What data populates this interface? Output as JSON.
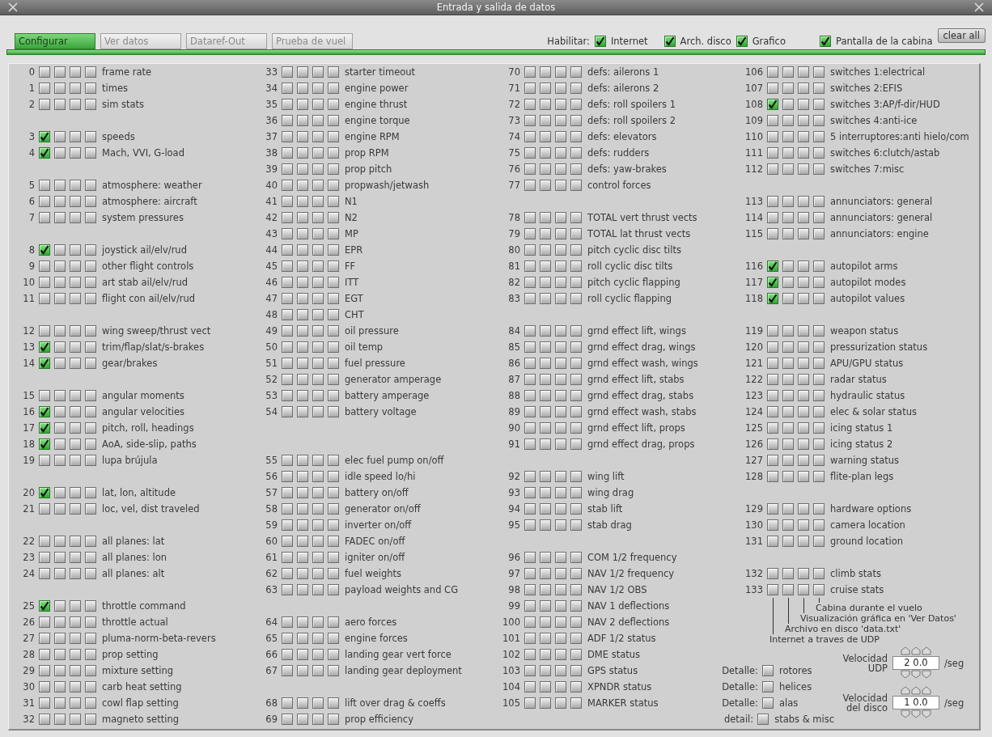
{
  "window": {
    "title": "Entrada y salida de datos"
  },
  "tabs": [
    {
      "label": "Configurar",
      "selected": true
    },
    {
      "label": "Ver datos",
      "selected": false
    },
    {
      "label": "Dataref-Out",
      "selected": false
    },
    {
      "label": "Prueba de vuel",
      "selected": false
    }
  ],
  "enable": {
    "label": "Habilitar:",
    "options": [
      {
        "label": "Internet",
        "checked": true
      },
      {
        "label": "Arch. disco",
        "checked": true
      },
      {
        "label": "Grafico",
        "checked": true
      },
      {
        "label": "Pantalla de la cabina",
        "checked": true
      }
    ]
  },
  "clear_button": "clear all",
  "columns": [
    {
      "rows": [
        {
          "kind": "entry",
          "number": "0",
          "label": "frame rate",
          "checks": [
            false,
            false,
            false,
            false
          ]
        },
        {
          "kind": "entry",
          "number": "1",
          "label": "times",
          "checks": [
            false,
            false,
            false,
            false
          ]
        },
        {
          "kind": "entry",
          "number": "2",
          "label": "sim stats",
          "checks": [
            false,
            false,
            false,
            false
          ]
        },
        {
          "kind": "blank"
        },
        {
          "kind": "entry",
          "number": "3",
          "label": "speeds",
          "checks": [
            true,
            false,
            false,
            false
          ]
        },
        {
          "kind": "entry",
          "number": "4",
          "label": "Mach, VVI, G-load",
          "checks": [
            true,
            false,
            false,
            false
          ]
        },
        {
          "kind": "blank"
        },
        {
          "kind": "entry",
          "number": "5",
          "label": "atmosphere: weather",
          "checks": [
            false,
            false,
            false,
            false
          ]
        },
        {
          "kind": "entry",
          "number": "6",
          "label": "atmosphere: aircraft",
          "checks": [
            false,
            false,
            false,
            false
          ]
        },
        {
          "kind": "entry",
          "number": "7",
          "label": "system pressures",
          "checks": [
            false,
            false,
            false,
            false
          ]
        },
        {
          "kind": "blank"
        },
        {
          "kind": "entry",
          "number": "8",
          "label": "joystick ail/elv/rud",
          "checks": [
            true,
            false,
            false,
            false
          ]
        },
        {
          "kind": "entry",
          "number": "9",
          "label": "other flight controls",
          "checks": [
            false,
            false,
            false,
            false
          ]
        },
        {
          "kind": "entry",
          "number": "10",
          "label": "art stab ail/elv/rud",
          "checks": [
            false,
            false,
            false,
            false
          ]
        },
        {
          "kind": "entry",
          "number": "11",
          "label": "flight con ail/elv/rud",
          "checks": [
            false,
            false,
            false,
            false
          ]
        },
        {
          "kind": "blank"
        },
        {
          "kind": "entry",
          "number": "12",
          "label": "wing sweep/thrust vect",
          "checks": [
            false,
            false,
            false,
            false
          ]
        },
        {
          "kind": "entry",
          "number": "13",
          "label": "trim/flap/slat/s-brakes",
          "checks": [
            true,
            false,
            false,
            false
          ]
        },
        {
          "kind": "entry",
          "number": "14",
          "label": "gear/brakes",
          "checks": [
            true,
            false,
            false,
            false
          ]
        },
        {
          "kind": "blank"
        },
        {
          "kind": "entry",
          "number": "15",
          "label": "angular moments",
          "checks": [
            false,
            false,
            false,
            false
          ]
        },
        {
          "kind": "entry",
          "number": "16",
          "label": "angular velocities",
          "checks": [
            true,
            false,
            false,
            false
          ]
        },
        {
          "kind": "entry",
          "number": "17",
          "label": "pitch, roll, headings",
          "checks": [
            true,
            false,
            false,
            false
          ]
        },
        {
          "kind": "entry",
          "number": "18",
          "label": "AoA, side-slip, paths",
          "checks": [
            true,
            false,
            false,
            false
          ]
        },
        {
          "kind": "entry",
          "number": "19",
          "label": "lupa brújula",
          "checks": [
            false,
            false,
            false,
            false
          ]
        },
        {
          "kind": "blank"
        },
        {
          "kind": "entry",
          "number": "20",
          "label": "lat, lon, altitude",
          "checks": [
            true,
            false,
            false,
            false
          ]
        },
        {
          "kind": "entry",
          "number": "21",
          "label": "loc, vel, dist traveled",
          "checks": [
            false,
            false,
            false,
            false
          ]
        },
        {
          "kind": "blank"
        },
        {
          "kind": "entry",
          "number": "22",
          "label": "all planes: lat",
          "checks": [
            false,
            false,
            false,
            false
          ]
        },
        {
          "kind": "entry",
          "number": "23",
          "label": "all planes: lon",
          "checks": [
            false,
            false,
            false,
            false
          ]
        },
        {
          "kind": "entry",
          "number": "24",
          "label": "all planes: alt",
          "checks": [
            false,
            false,
            false,
            false
          ]
        },
        {
          "kind": "blank"
        },
        {
          "kind": "entry",
          "number": "25",
          "label": "throttle command",
          "checks": [
            true,
            false,
            false,
            false
          ]
        },
        {
          "kind": "entry",
          "number": "26",
          "label": "throttle actual",
          "checks": [
            false,
            false,
            false,
            false
          ]
        },
        {
          "kind": "entry",
          "number": "27",
          "label": "pluma-norm-beta-revers",
          "checks": [
            false,
            false,
            false,
            false
          ]
        },
        {
          "kind": "entry",
          "number": "28",
          "label": "prop setting",
          "checks": [
            false,
            false,
            false,
            false
          ]
        },
        {
          "kind": "entry",
          "number": "29",
          "label": "mixture setting",
          "checks": [
            false,
            false,
            false,
            false
          ]
        },
        {
          "kind": "entry",
          "number": "30",
          "label": "carb heat setting",
          "checks": [
            false,
            false,
            false,
            false
          ]
        },
        {
          "kind": "entry",
          "number": "31",
          "label": "cowl flap setting",
          "checks": [
            false,
            false,
            false,
            false
          ]
        },
        {
          "kind": "entry",
          "number": "32",
          "label": "magneto setting",
          "checks": [
            false,
            false,
            false,
            false
          ]
        }
      ]
    },
    {
      "rows": [
        {
          "kind": "entry",
          "number": "33",
          "label": "starter timeout",
          "checks": [
            false,
            false,
            false,
            false
          ]
        },
        {
          "kind": "entry",
          "number": "34",
          "label": "engine power",
          "checks": [
            false,
            false,
            false,
            false
          ]
        },
        {
          "kind": "entry",
          "number": "35",
          "label": "engine thrust",
          "checks": [
            false,
            false,
            false,
            false
          ]
        },
        {
          "kind": "entry",
          "number": "36",
          "label": "engine torque",
          "checks": [
            false,
            false,
            false,
            false
          ]
        },
        {
          "kind": "entry",
          "number": "37",
          "label": "engine RPM",
          "checks": [
            false,
            false,
            false,
            false
          ]
        },
        {
          "kind": "entry",
          "number": "38",
          "label": "prop RPM",
          "checks": [
            false,
            false,
            false,
            false
          ]
        },
        {
          "kind": "entry",
          "number": "39",
          "label": "prop pitch",
          "checks": [
            false,
            false,
            false,
            false
          ]
        },
        {
          "kind": "entry",
          "number": "40",
          "label": "propwash/jetwash",
          "checks": [
            false,
            false,
            false,
            false
          ]
        },
        {
          "kind": "entry",
          "number": "41",
          "label": "N1",
          "checks": [
            false,
            false,
            false,
            false
          ]
        },
        {
          "kind": "entry",
          "number": "42",
          "label": "N2",
          "checks": [
            false,
            false,
            false,
            false
          ]
        },
        {
          "kind": "entry",
          "number": "43",
          "label": "MP",
          "checks": [
            false,
            false,
            false,
            false
          ]
        },
        {
          "kind": "entry",
          "number": "44",
          "label": "EPR",
          "checks": [
            false,
            false,
            false,
            false
          ]
        },
        {
          "kind": "entry",
          "number": "45",
          "label": "FF",
          "checks": [
            false,
            false,
            false,
            false
          ]
        },
        {
          "kind": "entry",
          "number": "46",
          "label": "ITT",
          "checks": [
            false,
            false,
            false,
            false
          ]
        },
        {
          "kind": "entry",
          "number": "47",
          "label": "EGT",
          "checks": [
            false,
            false,
            false,
            false
          ]
        },
        {
          "kind": "entry",
          "number": "48",
          "label": "CHT",
          "checks": [
            false,
            false,
            false,
            false
          ]
        },
        {
          "kind": "entry",
          "number": "49",
          "label": "oil pressure",
          "checks": [
            false,
            false,
            false,
            false
          ]
        },
        {
          "kind": "entry",
          "number": "50",
          "label": "oil temp",
          "checks": [
            false,
            false,
            false,
            false
          ]
        },
        {
          "kind": "entry",
          "number": "51",
          "label": "fuel pressure",
          "checks": [
            false,
            false,
            false,
            false
          ]
        },
        {
          "kind": "entry",
          "number": "52",
          "label": "generator amperage",
          "checks": [
            false,
            false,
            false,
            false
          ]
        },
        {
          "kind": "entry",
          "number": "53",
          "label": "battery amperage",
          "checks": [
            false,
            false,
            false,
            false
          ]
        },
        {
          "kind": "entry",
          "number": "54",
          "label": "battery voltage",
          "checks": [
            false,
            false,
            false,
            false
          ]
        },
        {
          "kind": "blank"
        },
        {
          "kind": "blank"
        },
        {
          "kind": "entry",
          "number": "55",
          "label": "elec fuel pump on/off",
          "checks": [
            false,
            false,
            false,
            false
          ]
        },
        {
          "kind": "entry",
          "number": "56",
          "label": "idle speed lo/hi",
          "checks": [
            false,
            false,
            false,
            false
          ]
        },
        {
          "kind": "entry",
          "number": "57",
          "label": "battery on/off",
          "checks": [
            false,
            false,
            false,
            false
          ]
        },
        {
          "kind": "entry",
          "number": "58",
          "label": "generator on/off",
          "checks": [
            false,
            false,
            false,
            false
          ]
        },
        {
          "kind": "entry",
          "number": "59",
          "label": "inverter on/off",
          "checks": [
            false,
            false,
            false,
            false
          ]
        },
        {
          "kind": "entry",
          "number": "60",
          "label": "FADEC on/off",
          "checks": [
            false,
            false,
            false,
            false
          ]
        },
        {
          "kind": "entry",
          "number": "61",
          "label": "igniter on/off",
          "checks": [
            false,
            false,
            false,
            false
          ]
        },
        {
          "kind": "entry",
          "number": "62",
          "label": "fuel weights",
          "checks": [
            false,
            false,
            false,
            false
          ]
        },
        {
          "kind": "entry",
          "number": "63",
          "label": "payload weights and CG",
          "checks": [
            false,
            false,
            false,
            false
          ]
        },
        {
          "kind": "blank"
        },
        {
          "kind": "entry",
          "number": "64",
          "label": "aero forces",
          "checks": [
            false,
            false,
            false,
            false
          ]
        },
        {
          "kind": "entry",
          "number": "65",
          "label": "engine forces",
          "checks": [
            false,
            false,
            false,
            false
          ]
        },
        {
          "kind": "entry",
          "number": "66",
          "label": "landing gear vert force",
          "checks": [
            false,
            false,
            false,
            false
          ]
        },
        {
          "kind": "entry",
          "number": "67",
          "label": "landing gear deployment",
          "checks": [
            false,
            false,
            false,
            false
          ]
        },
        {
          "kind": "blank"
        },
        {
          "kind": "entry",
          "number": "68",
          "label": "lift over drag & coeffs",
          "checks": [
            false,
            false,
            false,
            false
          ]
        },
        {
          "kind": "entry",
          "number": "69",
          "label": "prop efficiency",
          "checks": [
            false,
            false,
            false,
            false
          ]
        }
      ]
    },
    {
      "rows": [
        {
          "kind": "entry",
          "number": "70",
          "label": "defs: ailerons 1",
          "checks": [
            false,
            false,
            false,
            false
          ]
        },
        {
          "kind": "entry",
          "number": "71",
          "label": "defs: ailerons 2",
          "checks": [
            false,
            false,
            false,
            false
          ]
        },
        {
          "kind": "entry",
          "number": "72",
          "label": "defs: roll spoilers 1",
          "checks": [
            false,
            false,
            false,
            false
          ]
        },
        {
          "kind": "entry",
          "number": "73",
          "label": "defs: roll spoilers 2",
          "checks": [
            false,
            false,
            false,
            false
          ]
        },
        {
          "kind": "entry",
          "number": "74",
          "label": "defs: elevators",
          "checks": [
            false,
            false,
            false,
            false
          ]
        },
        {
          "kind": "entry",
          "number": "75",
          "label": "defs: rudders",
          "checks": [
            false,
            false,
            false,
            false
          ]
        },
        {
          "kind": "entry",
          "number": "76",
          "label": "defs: yaw-brakes",
          "checks": [
            false,
            false,
            false,
            false
          ]
        },
        {
          "kind": "entry",
          "number": "77",
          "label": "control forces",
          "checks": [
            false,
            false,
            false,
            false
          ]
        },
        {
          "kind": "blank"
        },
        {
          "kind": "entry",
          "number": "78",
          "label": "TOTAL vert thrust vects",
          "checks": [
            false,
            false,
            false,
            false
          ]
        },
        {
          "kind": "entry",
          "number": "79",
          "label": "TOTAL lat  thrust vects",
          "checks": [
            false,
            false,
            false,
            false
          ]
        },
        {
          "kind": "entry",
          "number": "80",
          "label": "pitch cyclic disc tilts",
          "checks": [
            false,
            false,
            false,
            false
          ]
        },
        {
          "kind": "entry",
          "number": "81",
          "label": "roll cyclic disc tilts",
          "checks": [
            false,
            false,
            false,
            false
          ]
        },
        {
          "kind": "entry",
          "number": "82",
          "label": "pitch cyclic flapping",
          "checks": [
            false,
            false,
            false,
            false
          ]
        },
        {
          "kind": "entry",
          "number": "83",
          "label": "roll cyclic flapping",
          "checks": [
            false,
            false,
            false,
            false
          ]
        },
        {
          "kind": "blank"
        },
        {
          "kind": "entry",
          "number": "84",
          "label": "grnd effect lift, wings",
          "checks": [
            false,
            false,
            false,
            false
          ]
        },
        {
          "kind": "entry",
          "number": "85",
          "label": "grnd effect drag, wings",
          "checks": [
            false,
            false,
            false,
            false
          ]
        },
        {
          "kind": "entry",
          "number": "86",
          "label": "grnd effect wash, wings",
          "checks": [
            false,
            false,
            false,
            false
          ]
        },
        {
          "kind": "entry",
          "number": "87",
          "label": "grnd effect lift, stabs",
          "checks": [
            false,
            false,
            false,
            false
          ]
        },
        {
          "kind": "entry",
          "number": "88",
          "label": "grnd effect drag, stabs",
          "checks": [
            false,
            false,
            false,
            false
          ]
        },
        {
          "kind": "entry",
          "number": "89",
          "label": "grnd effect wash, stabs",
          "checks": [
            false,
            false,
            false,
            false
          ]
        },
        {
          "kind": "entry",
          "number": "90",
          "label": "grnd effect lift, props",
          "checks": [
            false,
            false,
            false,
            false
          ]
        },
        {
          "kind": "entry",
          "number": "91",
          "label": "grnd effect drag, props",
          "checks": [
            false,
            false,
            false,
            false
          ]
        },
        {
          "kind": "blank"
        },
        {
          "kind": "entry",
          "number": "92",
          "label": "wing lift",
          "checks": [
            false,
            false,
            false,
            false
          ]
        },
        {
          "kind": "entry",
          "number": "93",
          "label": "wing drag",
          "checks": [
            false,
            false,
            false,
            false
          ]
        },
        {
          "kind": "entry",
          "number": "94",
          "label": "stab lift",
          "checks": [
            false,
            false,
            false,
            false
          ]
        },
        {
          "kind": "entry",
          "number": "95",
          "label": "stab drag",
          "checks": [
            false,
            false,
            false,
            false
          ]
        },
        {
          "kind": "blank"
        },
        {
          "kind": "entry",
          "number": "96",
          "label": "COM 1/2 frequency",
          "checks": [
            false,
            false,
            false,
            false
          ]
        },
        {
          "kind": "entry",
          "number": "97",
          "label": "NAV 1/2 frequency",
          "checks": [
            false,
            false,
            false,
            false
          ]
        },
        {
          "kind": "entry",
          "number": "98",
          "label": "NAV 1/2 OBS",
          "checks": [
            false,
            false,
            false,
            false
          ]
        },
        {
          "kind": "entry",
          "number": "99",
          "label": "NAV 1 deflections",
          "checks": [
            false,
            false,
            false,
            false
          ]
        },
        {
          "kind": "entry",
          "number": "100",
          "label": "NAV 2 deflections",
          "checks": [
            false,
            false,
            false,
            false
          ]
        },
        {
          "kind": "entry",
          "number": "101",
          "label": "ADF 1/2 status",
          "checks": [
            false,
            false,
            false,
            false
          ]
        },
        {
          "kind": "entry",
          "number": "102",
          "label": "DME status",
          "checks": [
            false,
            false,
            false,
            false
          ]
        },
        {
          "kind": "entry",
          "number": "103",
          "label": "GPS status",
          "checks": [
            false,
            false,
            false,
            false
          ]
        },
        {
          "kind": "entry",
          "number": "104",
          "label": "XPNDR status",
          "checks": [
            false,
            false,
            false,
            false
          ]
        },
        {
          "kind": "entry",
          "number": "105",
          "label": "MARKER status",
          "checks": [
            false,
            false,
            false,
            false
          ]
        }
      ]
    },
    {
      "rows": [
        {
          "kind": "entry",
          "number": "106",
          "label": "switches 1:electrical",
          "checks": [
            false,
            false,
            false,
            false
          ]
        },
        {
          "kind": "entry",
          "number": "107",
          "label": "switches 2:EFIS",
          "checks": [
            false,
            false,
            false,
            false
          ]
        },
        {
          "kind": "entry",
          "number": "108",
          "label": "switches 3:AP/f-dir/HUD",
          "checks": [
            true,
            false,
            false,
            false
          ]
        },
        {
          "kind": "entry",
          "number": "109",
          "label": "switches 4:anti-ice",
          "checks": [
            false,
            false,
            false,
            false
          ]
        },
        {
          "kind": "entry",
          "number": "110",
          "label": "5 interruptores:anti hielo/com",
          "checks": [
            false,
            false,
            false,
            false
          ]
        },
        {
          "kind": "entry",
          "number": "111",
          "label": "switches 6:clutch/astab",
          "checks": [
            false,
            false,
            false,
            false
          ]
        },
        {
          "kind": "entry",
          "number": "112",
          "label": "switches 7:misc",
          "checks": [
            false,
            false,
            false,
            false
          ]
        },
        {
          "kind": "blank"
        },
        {
          "kind": "entry",
          "number": "113",
          "label": "annunciators: general",
          "checks": [
            false,
            false,
            false,
            false
          ]
        },
        {
          "kind": "entry",
          "number": "114",
          "label": "annunciators: general",
          "checks": [
            false,
            false,
            false,
            false
          ]
        },
        {
          "kind": "entry",
          "number": "115",
          "label": "annunciators: engine",
          "checks": [
            false,
            false,
            false,
            false
          ]
        },
        {
          "kind": "blank"
        },
        {
          "kind": "entry",
          "number": "116",
          "label": "autopilot arms",
          "checks": [
            true,
            false,
            false,
            false
          ]
        },
        {
          "kind": "entry",
          "number": "117",
          "label": "autopilot modes",
          "checks": [
            true,
            false,
            false,
            false
          ]
        },
        {
          "kind": "entry",
          "number": "118",
          "label": "autopilot values",
          "checks": [
            true,
            false,
            false,
            false
          ]
        },
        {
          "kind": "blank"
        },
        {
          "kind": "entry",
          "number": "119",
          "label": "weapon status",
          "checks": [
            false,
            false,
            false,
            false
          ]
        },
        {
          "kind": "entry",
          "number": "120",
          "label": "pressurization status",
          "checks": [
            false,
            false,
            false,
            false
          ]
        },
        {
          "kind": "entry",
          "number": "121",
          "label": "APU/GPU status",
          "checks": [
            false,
            false,
            false,
            false
          ]
        },
        {
          "kind": "entry",
          "number": "122",
          "label": "radar status",
          "checks": [
            false,
            false,
            false,
            false
          ]
        },
        {
          "kind": "entry",
          "number": "123",
          "label": "hydraulic status",
          "checks": [
            false,
            false,
            false,
            false
          ]
        },
        {
          "kind": "entry",
          "number": "124",
          "label": "elec & solar status",
          "checks": [
            false,
            false,
            false,
            false
          ]
        },
        {
          "kind": "entry",
          "number": "125",
          "label": "icing status 1",
          "checks": [
            false,
            false,
            false,
            false
          ]
        },
        {
          "kind": "entry",
          "number": "126",
          "label": "icing status 2",
          "checks": [
            false,
            false,
            false,
            false
          ]
        },
        {
          "kind": "entry",
          "number": "127",
          "label": "warning status",
          "checks": [
            false,
            false,
            false,
            false
          ]
        },
        {
          "kind": "entry",
          "number": "128",
          "label": "flite-plan legs",
          "checks": [
            false,
            false,
            false,
            false
          ]
        },
        {
          "kind": "blank"
        },
        {
          "kind": "entry",
          "number": "129",
          "label": "hardware options",
          "checks": [
            false,
            false,
            false,
            false
          ]
        },
        {
          "kind": "entry",
          "number": "130",
          "label": "camera location",
          "checks": [
            false,
            false,
            false,
            false
          ]
        },
        {
          "kind": "entry",
          "number": "131",
          "label": "ground location",
          "checks": [
            false,
            false,
            false,
            false
          ]
        },
        {
          "kind": "blank"
        },
        {
          "kind": "entry",
          "number": "132",
          "label": "climb stats",
          "checks": [
            false,
            false,
            false,
            false
          ]
        },
        {
          "kind": "entry",
          "number": "133",
          "label": "cruise stats",
          "checks": [
            false,
            false,
            false,
            false
          ]
        }
      ]
    }
  ],
  "legend": [
    "Cabina durante el vuelo",
    "Visualización gráfica en 'Ver Datos'",
    "Archivo en disco 'data.txt'",
    "Internet a traves de UDP"
  ],
  "details": [
    {
      "prefix": "Detalle:",
      "label": "rotores",
      "checked": false
    },
    {
      "prefix": "Detalle:",
      "label": "helices",
      "checked": false
    },
    {
      "prefix": "Detalle:",
      "label": "alas",
      "checked": false
    },
    {
      "prefix": "detail:",
      "label": "stabs & misc",
      "checked": false
    }
  ],
  "rates": [
    {
      "label": "Velocidad UDP",
      "value": "2 0.0",
      "unit": "/seg"
    },
    {
      "label": "Velocidad del disco",
      "value": "1 0.0",
      "unit": "/seg"
    }
  ]
}
